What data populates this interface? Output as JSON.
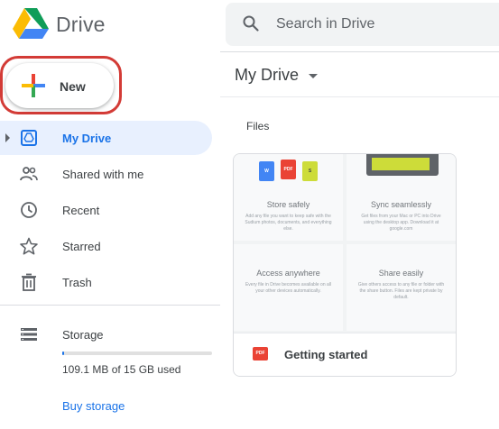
{
  "header": {
    "app_name": "Drive",
    "search_placeholder": "Search in Drive"
  },
  "new_button": {
    "label": "New"
  },
  "sidebar": {
    "items": [
      {
        "label": "My Drive",
        "icon": "drive-folder-icon",
        "active": true
      },
      {
        "label": "Shared with me",
        "icon": "people-icon",
        "active": false
      },
      {
        "label": "Recent",
        "icon": "clock-icon",
        "active": false
      },
      {
        "label": "Starred",
        "icon": "star-icon",
        "active": false
      },
      {
        "label": "Trash",
        "icon": "trash-icon",
        "active": false
      }
    ],
    "storage": {
      "label": "Storage",
      "icon": "storage-icon",
      "used_text": "109.1 MB of 15 GB used",
      "used_fraction": 0.007,
      "buy_label": "Buy storage"
    }
  },
  "main": {
    "title": "My Drive",
    "section_label": "Files",
    "files": [
      {
        "name": "Getting started",
        "type_badge": "PDF",
        "thumbnail": {
          "tiles": [
            {
              "title": "Store safely",
              "text": "Add any file you want to keep safe with the Sudium photos, documents, and everything else."
            },
            {
              "title": "Sync seamlessly",
              "text": "Get files from your Mac or PC into Drive using the desktop app. Download it at google.com"
            },
            {
              "title": "Access anywhere",
              "text": "Every file in Drive becomes available on all your other devices automatically."
            },
            {
              "title": "Share easily",
              "text": "Give others access to any file or folder with the share button. Files are kept private by default."
            }
          ],
          "mini_docs": [
            "W",
            "PDF",
            "S"
          ]
        }
      }
    ]
  },
  "colors": {
    "accent": "#1a73e8",
    "active_bg": "#e8f0fe",
    "highlight_ring": "#d33b36",
    "pdf_red": "#ea4335"
  }
}
